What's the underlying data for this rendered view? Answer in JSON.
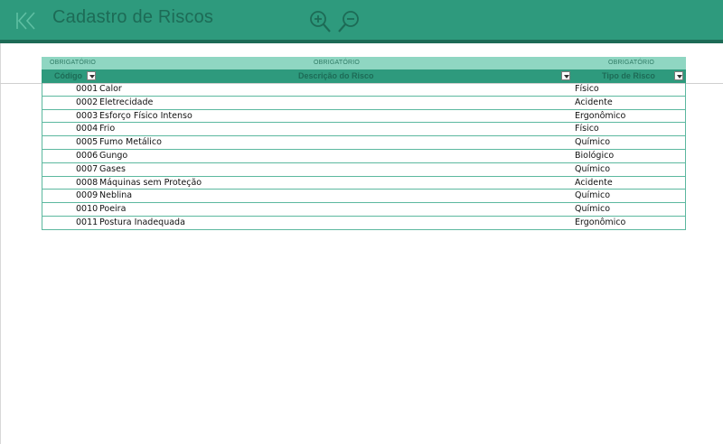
{
  "header": {
    "title": "Cadastro de Riscos",
    "icons": {
      "first": "skip-to-first-icon",
      "zoom_in": "zoom-in-icon",
      "zoom_out": "zoom-out-icon"
    }
  },
  "table": {
    "required_labels": [
      "OBRIGATÓRIO",
      "OBRIGATÓRIO",
      "OBRIGATÓRIO"
    ],
    "columns": {
      "code": "Código",
      "description": "Descrição do Risco",
      "type": "Tipo de Risco"
    },
    "rows": [
      {
        "code": "0001",
        "description": "Calor",
        "type": "Físico"
      },
      {
        "code": "0002",
        "description": "Eletrecidade",
        "type": "Acidente"
      },
      {
        "code": "0003",
        "description": "Esforço Físico Intenso",
        "type": "Ergonômico"
      },
      {
        "code": "0004",
        "description": "Frio",
        "type": "Físico"
      },
      {
        "code": "0005",
        "description": "Fumo Metálico",
        "type": "Químico"
      },
      {
        "code": "0006",
        "description": "Gungo",
        "type": "Biológico"
      },
      {
        "code": "0007",
        "description": "Gases",
        "type": "Químico"
      },
      {
        "code": "0008",
        "description": "Máquinas sem Proteção",
        "type": "Acidente"
      },
      {
        "code": "0009",
        "description": "Neblina",
        "type": "Químico"
      },
      {
        "code": "0010",
        "description": "Poeira",
        "type": "Químico"
      },
      {
        "code": "0011",
        "description": "Postura Inadequada",
        "type": "Ergonômico"
      }
    ]
  },
  "colors": {
    "header": "#2e9a7d",
    "header_dark": "#1d6b56",
    "required_band": "#8fd6c2",
    "grid": "#5cb89f"
  }
}
